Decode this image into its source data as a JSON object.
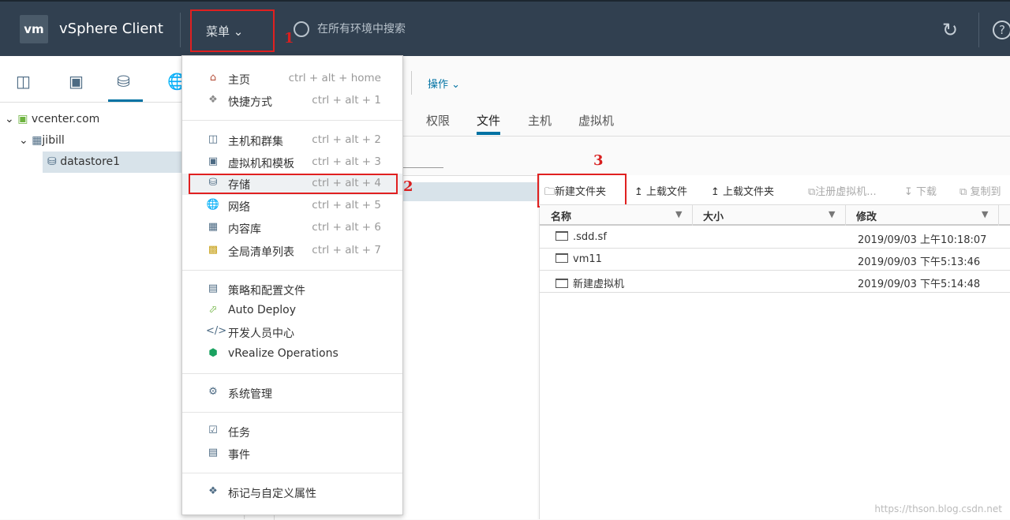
{
  "header": {
    "logo": "vm",
    "app_title": "vSphere Client",
    "menu_label": "菜单",
    "search_placeholder": "在所有环境中搜索",
    "icons": [
      "refresh-icon",
      "help-icon"
    ]
  },
  "annotations": [
    "1",
    "2",
    "3"
  ],
  "nav_tabs": [
    "hosts-clusters-icon",
    "vms-templates-icon",
    "storage-icon",
    "network-icon"
  ],
  "tree": [
    {
      "label": "vcenter.com",
      "level": 0
    },
    {
      "label": "jibill",
      "level": 1
    },
    {
      "label": "datastore1",
      "level": 2,
      "selected": true
    }
  ],
  "actions_label": "操作",
  "tabs": [
    {
      "label": "权限"
    },
    {
      "label": "文件",
      "active": true
    },
    {
      "label": "主机"
    },
    {
      "label": "虚拟机"
    }
  ],
  "toolbar": {
    "new_folder": "新建文件夹",
    "upload_file": "上载文件",
    "upload_folder": "上载文件夹",
    "register_vm": "注册虚拟机...",
    "download": "下载",
    "copy_to": "复制到"
  },
  "table": {
    "columns": [
      "名称",
      "大小",
      "修改"
    ],
    "rows": [
      {
        "name": ".sdd.sf",
        "size": "",
        "modified": "2019/09/03 上午10:18:07"
      },
      {
        "name": "vm11",
        "size": "",
        "modified": "2019/09/03 下午5:13:46"
      },
      {
        "name": "新建虚拟机",
        "size": "",
        "modified": "2019/09/03 下午5:14:48"
      }
    ]
  },
  "menu": {
    "items": [
      {
        "label": "主页",
        "shortcut": "ctrl + alt + home",
        "icon": "home-icon"
      },
      {
        "label": "快捷方式",
        "shortcut": "ctrl + alt + 1",
        "icon": "shortcuts-icon"
      },
      {
        "label": "主机和群集",
        "shortcut": "ctrl + alt + 2",
        "icon": "hosts-clusters-icon"
      },
      {
        "label": "虚拟机和模板",
        "shortcut": "ctrl + alt + 3",
        "icon": "vms-templates-icon"
      },
      {
        "label": "存储",
        "shortcut": "ctrl + alt + 4",
        "icon": "storage-icon"
      },
      {
        "label": "网络",
        "shortcut": "ctrl + alt + 5",
        "icon": "network-icon"
      },
      {
        "label": "内容库",
        "shortcut": "ctrl + alt + 6",
        "icon": "content-library-icon"
      },
      {
        "label": "全局清单列表",
        "shortcut": "ctrl + alt + 7",
        "icon": "global-inventory-icon"
      },
      {
        "label": "策略和配置文件",
        "icon": "policies-icon"
      },
      {
        "label": "Auto Deploy",
        "icon": "auto-deploy-icon"
      },
      {
        "label": "开发人员中心",
        "icon": "developer-center-icon"
      },
      {
        "label": "vRealize Operations",
        "icon": "vrealize-icon"
      },
      {
        "label": "系统管理",
        "icon": "administration-icon"
      },
      {
        "label": "任务",
        "icon": "tasks-icon"
      },
      {
        "label": "事件",
        "icon": "events-icon"
      },
      {
        "label": "标记与自定义属性",
        "icon": "tags-icon"
      }
    ]
  },
  "watermark": "https://thson.blog.csdn.net",
  "colors": {
    "header": "#314050",
    "accent": "#0072a3",
    "highlight_box": "#e02020"
  }
}
